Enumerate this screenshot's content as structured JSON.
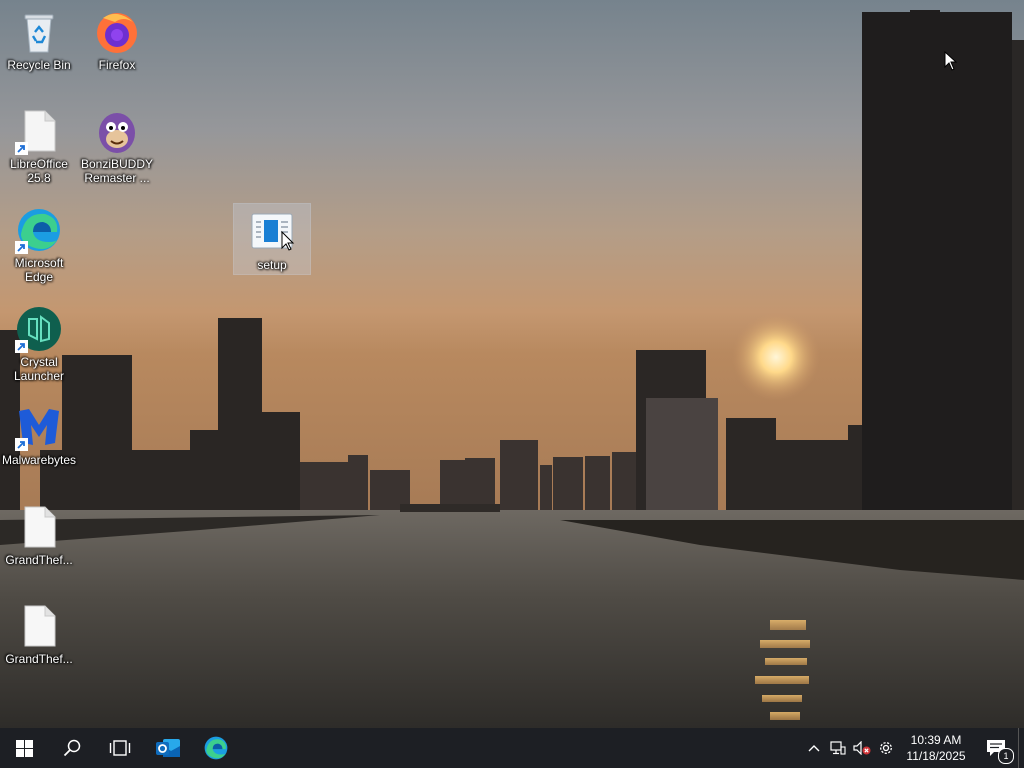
{
  "desktop": {
    "icons": [
      {
        "label": "Recycle Bin",
        "icon": "recycle-bin-icon",
        "shortcut": false
      },
      {
        "label": "Firefox",
        "icon": "firefox-icon",
        "shortcut": false
      },
      {
        "label": "LibreOffice 25.8",
        "icon": "libreoffice-icon",
        "shortcut": true
      },
      {
        "label": "BonziBUDDY Remaster ...",
        "icon": "bonzibuddy-icon",
        "shortcut": false
      },
      {
        "label": "Microsoft Edge",
        "icon": "edge-icon",
        "shortcut": true
      },
      {
        "label": "setup",
        "icon": "setup-icon",
        "shortcut": false,
        "selected": true
      },
      {
        "label": "Crystal Launcher",
        "icon": "crystal-launcher-icon",
        "shortcut": true
      },
      {
        "label": "Malwarebytes",
        "icon": "malwarebytes-icon",
        "shortcut": true
      },
      {
        "label": "GrandThef...",
        "icon": "file-icon",
        "shortcut": false
      },
      {
        "label": "GrandThef...",
        "icon": "file-icon",
        "shortcut": false
      }
    ]
  },
  "taskbar": {
    "buttons": [
      "start-icon",
      "search-icon",
      "task-view-icon",
      "outlook-icon",
      "edge-icon"
    ],
    "tray": {
      "icons": [
        "chevron-up-icon",
        "network-icon",
        "volume-muted-icon",
        "settings-gear-icon"
      ],
      "time": "10:39 AM",
      "date": "11/18/2025",
      "notification_count": "1"
    }
  },
  "colors": {
    "taskbar_bg": "#1d1f24",
    "sky_top": "#7f8d97",
    "sky_horizon": "#c79a6f",
    "water": "#4e4a44",
    "accent_blue": "#0078d4"
  }
}
